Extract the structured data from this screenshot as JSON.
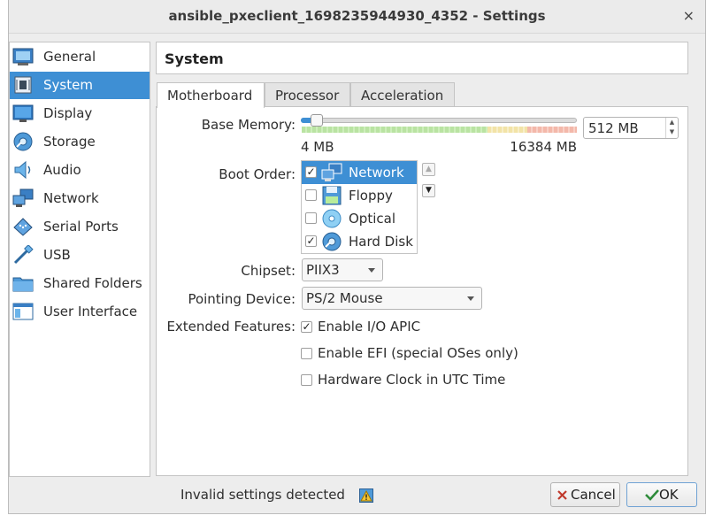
{
  "window": {
    "title": "ansible_pxeclient_1698235944930_4352 - Settings",
    "close_glyph": "×"
  },
  "sidebar": {
    "items": [
      {
        "label": "General",
        "icon": "general-icon"
      },
      {
        "label": "System",
        "icon": "system-icon",
        "selected": true
      },
      {
        "label": "Display",
        "icon": "display-icon"
      },
      {
        "label": "Storage",
        "icon": "storage-icon"
      },
      {
        "label": "Audio",
        "icon": "audio-icon"
      },
      {
        "label": "Network",
        "icon": "network-icon"
      },
      {
        "label": "Serial Ports",
        "icon": "serial-ports-icon"
      },
      {
        "label": "USB",
        "icon": "usb-icon"
      },
      {
        "label": "Shared Folders",
        "icon": "shared-folders-icon"
      },
      {
        "label": "User Interface",
        "icon": "user-interface-icon"
      }
    ]
  },
  "page": {
    "title": "System"
  },
  "tabs": [
    {
      "label": "Motherboard",
      "active": true
    },
    {
      "label": "Processor"
    },
    {
      "label": "Acceleration"
    }
  ],
  "motherboard": {
    "base_memory_label": "Base Memory:",
    "base_memory_value": "512 MB",
    "memory_min": "4 MB",
    "memory_max": "16384 MB",
    "memory_slider_fraction": 0.031,
    "boot_order_label": "Boot Order:",
    "boot_order": [
      {
        "label": "Network",
        "checked": true,
        "selected": true,
        "icon": "network-boot-icon"
      },
      {
        "label": "Floppy",
        "checked": false,
        "icon": "floppy-icon"
      },
      {
        "label": "Optical",
        "checked": false,
        "icon": "optical-icon"
      },
      {
        "label": "Hard Disk",
        "checked": true,
        "icon": "hard-disk-icon"
      }
    ],
    "chipset_label": "Chipset:",
    "chipset_value": "PIIX3",
    "pointing_device_label": "Pointing Device:",
    "pointing_device_value": "PS/2 Mouse",
    "extended_features_label": "Extended Features:",
    "features": [
      {
        "label": "Enable I/O APIC",
        "checked": true
      },
      {
        "label": "Enable EFI (special OSes only)",
        "checked": false
      },
      {
        "label": "Hardware Clock in UTC Time",
        "checked": false
      }
    ]
  },
  "footer": {
    "status": "Invalid settings detected",
    "cancel_label": "Cancel",
    "ok_label": "OK"
  },
  "colors": {
    "selection": "#3e8fd4",
    "panel": "#ffffff",
    "window": "#ededed"
  }
}
